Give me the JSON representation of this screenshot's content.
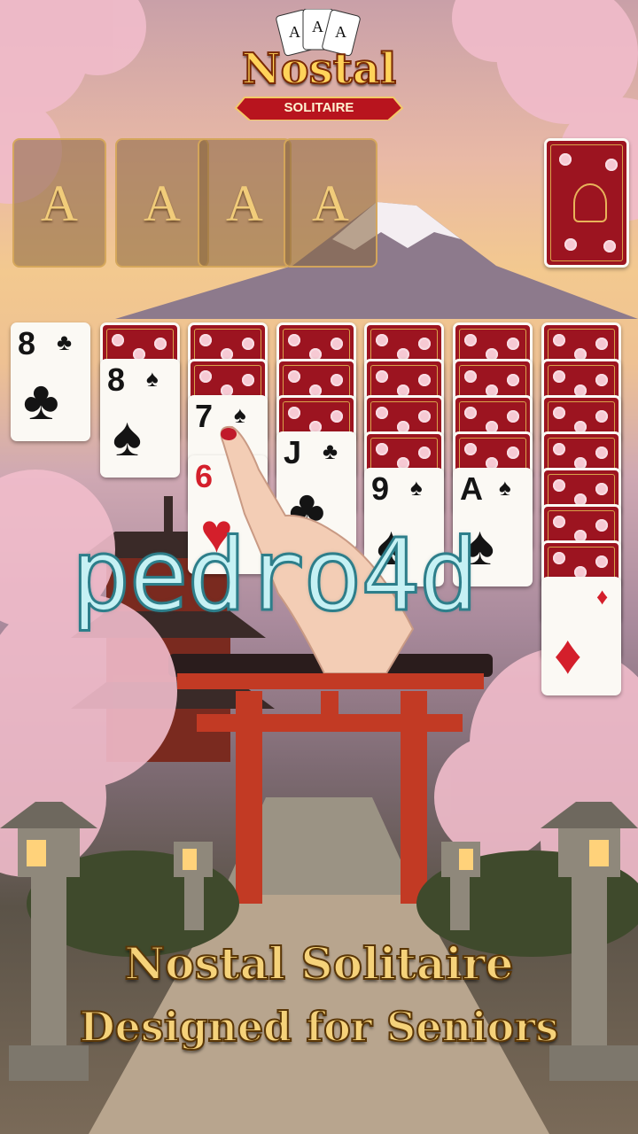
{
  "logo": {
    "title": "Nostal",
    "subtitle": "SOLITAIRE"
  },
  "foundations": [
    "A",
    "A",
    "A",
    "A"
  ],
  "tableau": [
    {
      "hidden": 0,
      "up": [
        {
          "rank": "8",
          "suit": "♣",
          "color": "black"
        }
      ]
    },
    {
      "hidden": 1,
      "up": [
        {
          "rank": "8",
          "suit": "♠",
          "color": "black"
        }
      ]
    },
    {
      "hidden": 2,
      "up": [
        {
          "rank": "7",
          "suit": "♠",
          "color": "black"
        },
        {
          "rank": "6",
          "suit": "♥",
          "color": "red"
        }
      ]
    },
    {
      "hidden": 3,
      "up": [
        {
          "rank": "J",
          "suit": "♣",
          "color": "black"
        }
      ]
    },
    {
      "hidden": 4,
      "up": [
        {
          "rank": "9",
          "suit": "♠",
          "color": "black"
        }
      ]
    },
    {
      "hidden": 4,
      "up": [
        {
          "rank": "A",
          "suit": "♠",
          "color": "black"
        }
      ]
    },
    {
      "hidden": 7,
      "up": [
        {
          "rank": "",
          "suit": "♦",
          "color": "red"
        }
      ]
    }
  ],
  "watermark": "pedro4d",
  "tagline": {
    "line1": "Nostal Solitaire",
    "line2": "Designed for Seniors"
  },
  "colors": {
    "card_back": "#9c1420",
    "gold": "#f1cc7a",
    "torii": "#c23a24"
  }
}
